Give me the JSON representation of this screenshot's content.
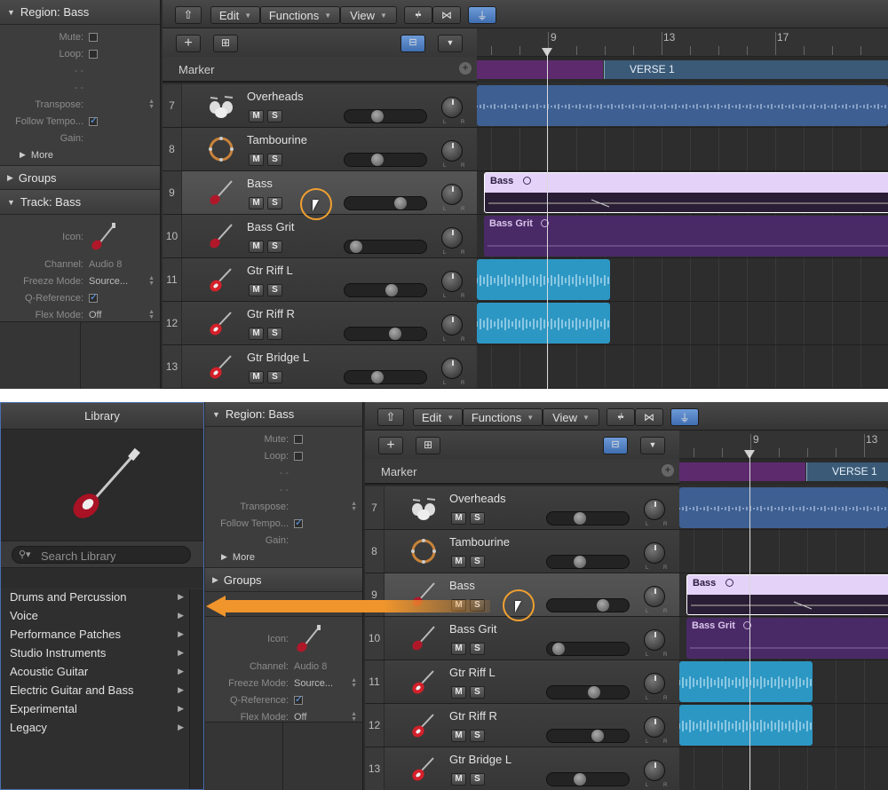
{
  "inspector": {
    "region_title": "Region: Bass",
    "mute_label": "Mute:",
    "loop_label": "Loop:",
    "dash1": "- -",
    "dash2": "- -",
    "transpose_label": "Transpose:",
    "follow_tempo_label": "Follow Tempo...",
    "gain_label": "Gain:",
    "more_label": "More",
    "groups_title": "Groups",
    "track_title": "Track:  Bass",
    "icon_label": "Icon:",
    "channel_label": "Channel:",
    "channel_value": "Audio 8",
    "freeze_label": "Freeze Mode:",
    "freeze_value": "Source...",
    "qref_label": "Q-Reference:",
    "flex_label": "Flex Mode:",
    "flex_value": "Off"
  },
  "toolbar": {
    "edit": "Edit",
    "functions": "Functions",
    "view": "View"
  },
  "ruler_top": {
    "bar9": "9",
    "bar13": "13",
    "bar17": "17"
  },
  "ruler_bottom": {
    "bar9": "9",
    "bar13": "13"
  },
  "marker": {
    "label": "Marker",
    "verse": "VERSE 1"
  },
  "tracks": [
    {
      "num": "7",
      "name": "Overheads"
    },
    {
      "num": "8",
      "name": "Tambourine"
    },
    {
      "num": "9",
      "name": "Bass"
    },
    {
      "num": "10",
      "name": "Bass Grit"
    },
    {
      "num": "11",
      "name": "Gtr Riff L"
    },
    {
      "num": "12",
      "name": "Gtr Riff R"
    },
    {
      "num": "13",
      "name": "Gtr  Bridge L"
    }
  ],
  "mute": "M",
  "solo": "S",
  "regions": {
    "bass": "Bass",
    "bassgrit": "Bass Grit"
  },
  "library": {
    "title": "Library",
    "search_placeholder": "Search Library",
    "items": [
      "Drums and Percussion",
      "Voice",
      "Performance Patches",
      "Studio Instruments",
      "Acoustic Guitar",
      "Electric Guitar and Bass",
      "Experimental",
      "Legacy"
    ]
  },
  "colors": {
    "bass_region": "#e4d2f8",
    "purple_region": "#4a2a66",
    "blue_region": "#3e5f92",
    "cyan_region": "#2d97c4",
    "arrow": "#f0952c"
  }
}
